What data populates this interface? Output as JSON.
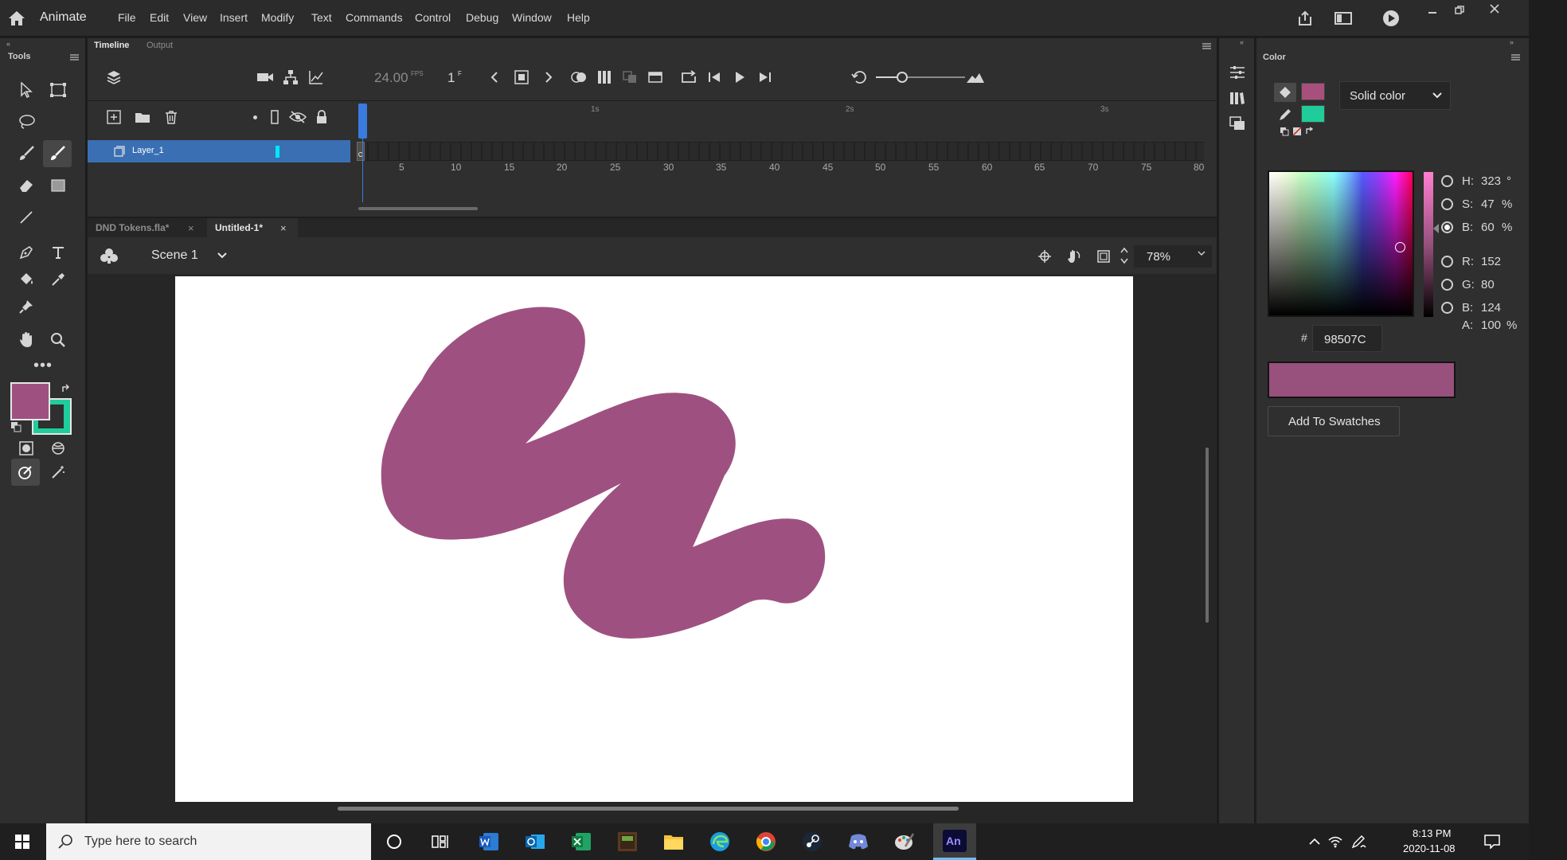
{
  "app": {
    "name": "Animate"
  },
  "menu": [
    "File",
    "Edit",
    "View",
    "Insert",
    "Modify",
    "Text",
    "Commands",
    "Control",
    "Debug",
    "Window",
    "Help"
  ],
  "tools_panel": {
    "title": "Tools"
  },
  "timeline": {
    "tabs": [
      "Timeline",
      "Output"
    ],
    "fps": "24.00",
    "fps_unit": "FPS",
    "frame": "1",
    "frame_unit": "F",
    "time_markers": [
      "1s",
      "2s",
      "3s"
    ],
    "frame_numbers": [
      "5",
      "10",
      "15",
      "20",
      "25",
      "30",
      "35",
      "40",
      "45",
      "50",
      "55",
      "60",
      "65",
      "70",
      "75",
      "80"
    ],
    "layers": [
      {
        "name": "Layer_1"
      }
    ]
  },
  "documents": [
    {
      "name": "DND Tokens.fla*",
      "active": false
    },
    {
      "name": "Untitled-1*",
      "active": true
    }
  ],
  "scene": {
    "name": "Scene 1",
    "zoom": "78%"
  },
  "stage": {
    "stroke_color": "#9E5180"
  },
  "color_panel": {
    "title": "Color",
    "fill_type": "Solid color",
    "stroke_color": "#A8507C",
    "fill_color": "#1FCC9A",
    "h_label": "H:",
    "h_value": "323",
    "h_unit": "°",
    "s_label": "S:",
    "s_value": "47",
    "s_unit": "%",
    "b_label": "B:",
    "b_value": "60",
    "b_unit": "%",
    "r_label": "R:",
    "r_value": "152",
    "g_label": "G:",
    "g_value": "80",
    "bl_label": "B:",
    "bl_value": "124",
    "a_label": "A:",
    "a_value": "100",
    "a_unit": "%",
    "hex_prefix": "#",
    "hex": "98507C",
    "add_swatch": "Add To Swatches",
    "selected_mode": "B"
  },
  "colors": {
    "current": "#98507C",
    "accent_blue": "#2f6eb5",
    "layer_highlight": "#3a70b3"
  },
  "taskbar": {
    "search_placeholder": "Type here to search",
    "time": "8:13 PM",
    "date": "2020-11-08"
  }
}
